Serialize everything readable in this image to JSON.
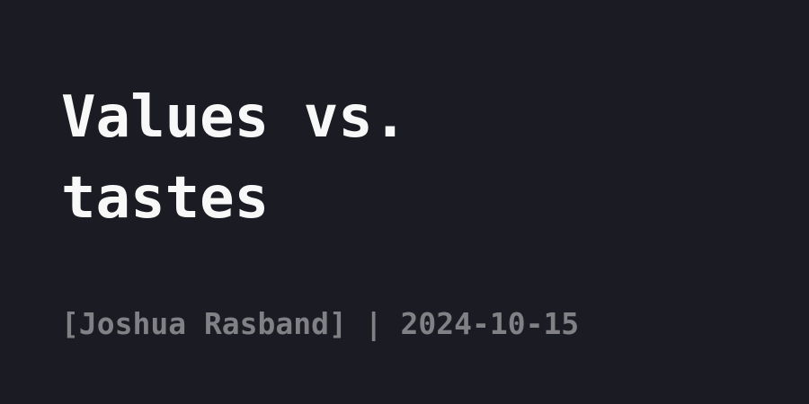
{
  "title": {
    "line1": "Values vs.",
    "line2": "tastes"
  },
  "byline": {
    "author_text": "[Joshua Rasband]",
    "separator": " | ",
    "date": "2024-10-15"
  },
  "colors": {
    "background": "#1b1c23",
    "title": "#f8f8f8",
    "byline": "#808085"
  }
}
